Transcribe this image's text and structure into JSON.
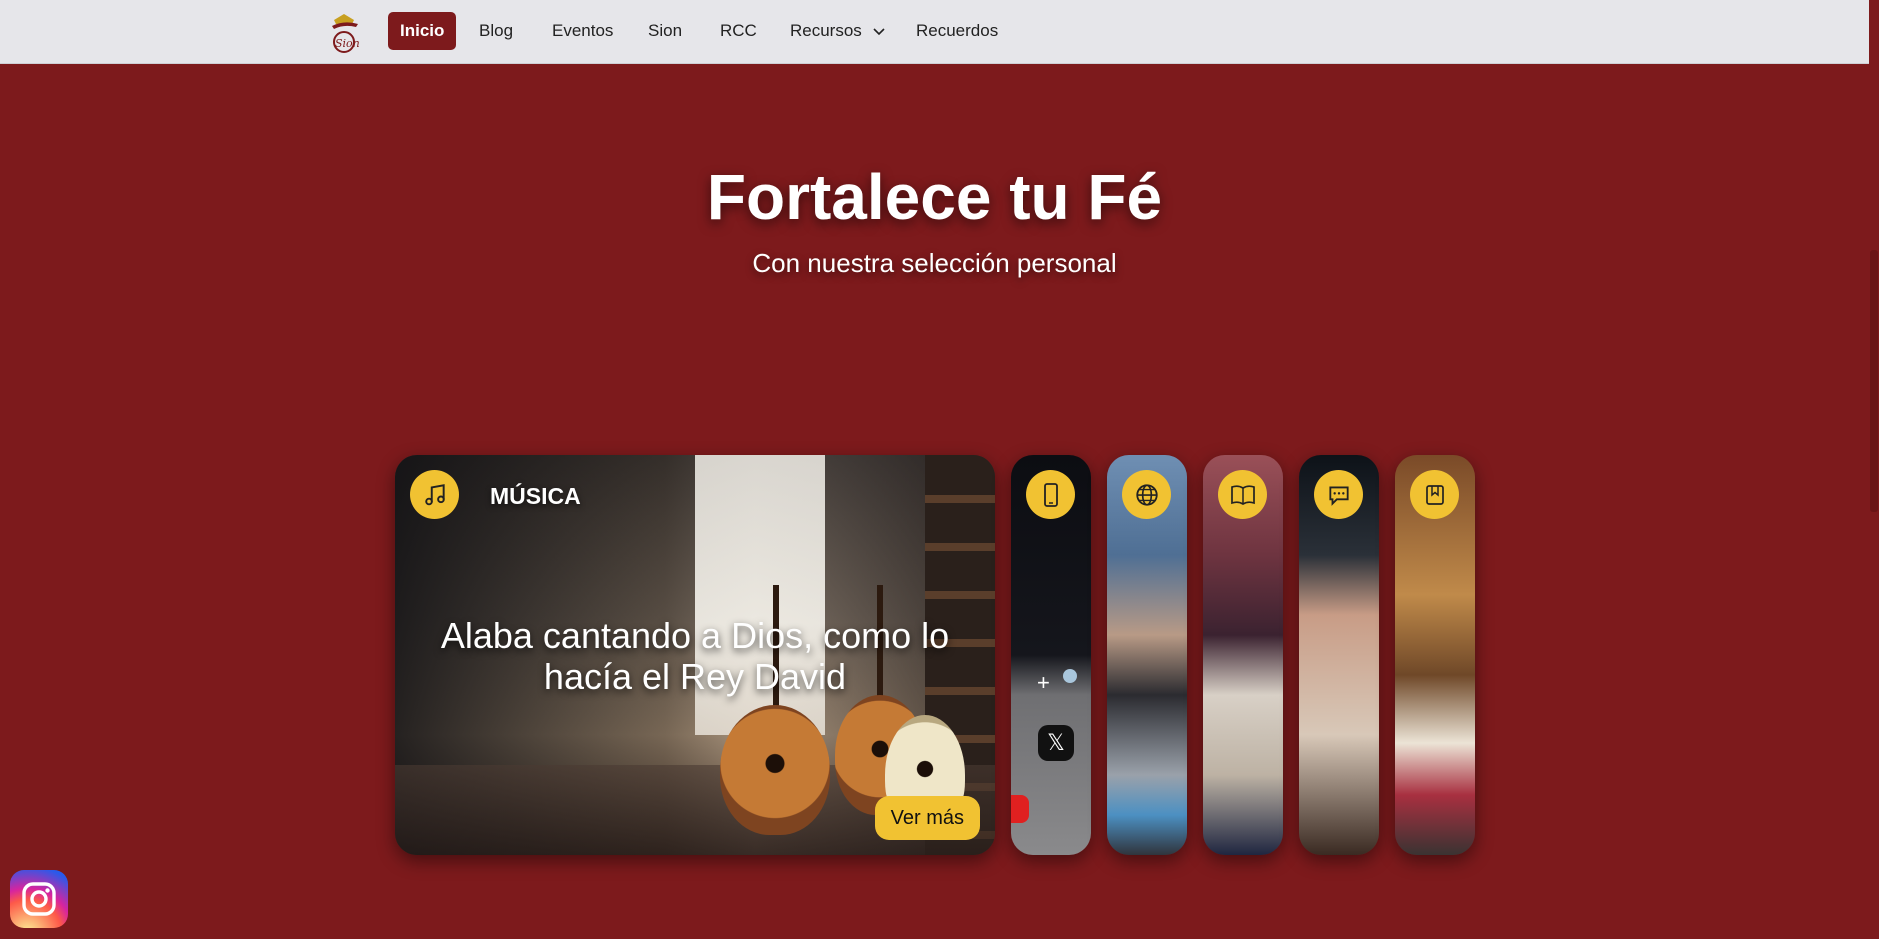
{
  "navbar": {
    "logo_text": "Sion",
    "items": [
      {
        "label": "Inicio",
        "active": true
      },
      {
        "label": "Blog"
      },
      {
        "label": "Eventos"
      },
      {
        "label": "Sion"
      },
      {
        "label": "RCC"
      },
      {
        "label": "Recursos",
        "has_dropdown": true
      },
      {
        "label": "Recuerdos"
      }
    ]
  },
  "hero": {
    "title": "Fortalece tu Fé",
    "subtitle": "Con nuestra selección personal"
  },
  "cards": {
    "main": {
      "icon": "music-note-icon",
      "label": "MÚSICA",
      "text": "Alaba cantando a Dios, como lo hacía el Rey David",
      "button": "Ver más"
    },
    "slim": [
      {
        "icon": "phone-icon"
      },
      {
        "icon": "globe-icon"
      },
      {
        "icon": "book-icon"
      },
      {
        "icon": "chat-icon"
      },
      {
        "icon": "bookmark-icon"
      }
    ]
  },
  "social": {
    "icon": "instagram-icon"
  },
  "colors": {
    "background": "#7d1a1c",
    "navbar": "#e6e6ea",
    "accent": "#f1c232",
    "active_nav": "#7d1a1c"
  }
}
